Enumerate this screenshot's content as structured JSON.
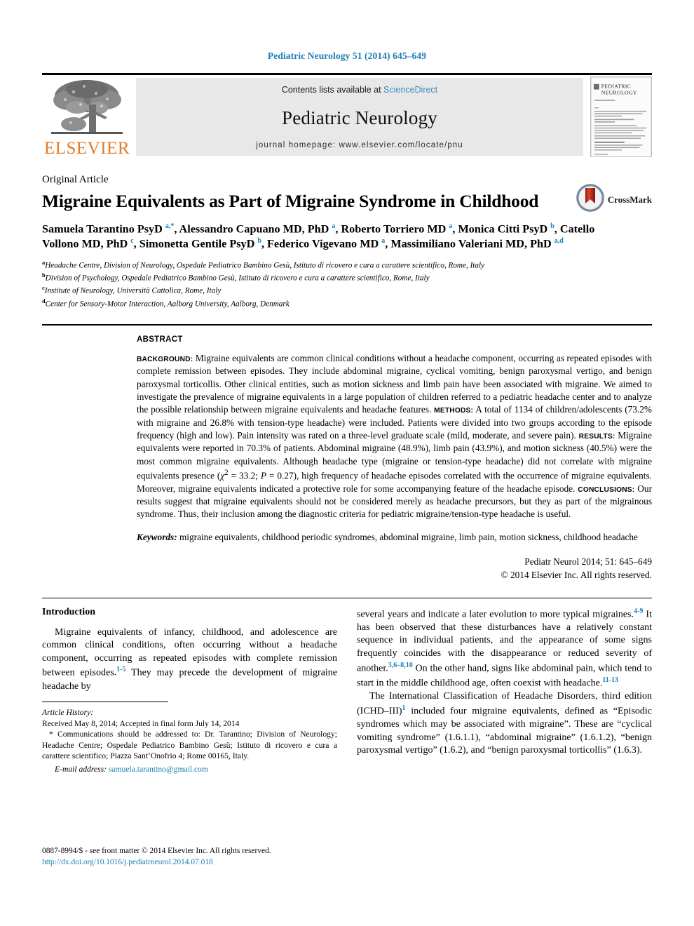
{
  "running_head": "Pediatric Neurology 51 (2014) 645–649",
  "masthead": {
    "elsevier_wordmark": "ELSEVIER",
    "contents_prefix": "Contents lists available at ",
    "sciencedirect": "ScienceDirect",
    "journal_title": "Pediatric Neurology",
    "homepage": "journal homepage: www.elsevier.com/locate/pnu",
    "cover_title_line1": "PEDIATRIC",
    "cover_title_line2": "NEUROLOGY"
  },
  "article": {
    "kicker": "Original Article",
    "title": "Migraine Equivalents as Part of Migraine Syndrome in Childhood",
    "crossmark_label": "CrossMark",
    "authors_html": "Samuela Tarantino PsyD <sup>a,*</sup>, Alessandro Capuano MD, PhD <sup>a</sup>, Roberto Torriero MD <sup>a</sup>, Monica Citti PsyD <sup>b</sup>, Catello Vollono MD, PhD <sup>c</sup>, Simonetta Gentile PsyD <sup>b</sup>, Federico Vigevano MD <sup>a</sup>, Massimiliano Valeriani MD, PhD <sup>a,d</sup>",
    "affiliations": [
      {
        "mark": "a",
        "text": "Headache Centre, Division of Neurology, Ospedale Pediatrico Bambino Gesù, Istituto di ricovero e cura a carattere scientifico, Rome, Italy"
      },
      {
        "mark": "b",
        "text": "Division of Psychology, Ospedale Pediatrico Bambino Gesù, Istituto di ricovero e cura a carattere scientifico, Rome, Italy"
      },
      {
        "mark": "c",
        "text": "Institute of Neurology, Università Cattolica, Rome, Italy"
      },
      {
        "mark": "d",
        "text": "Center for Sensory-Motor Interaction, Aalborg University, Aalborg, Denmark"
      }
    ]
  },
  "abstract": {
    "label": "ABSTRACT",
    "background_label": "BACKGROUND:",
    "background_text": " Migraine equivalents are common clinical conditions without a headache component, occurring as repeated episodes with complete remission between episodes. They include abdominal migraine, cyclical vomiting, benign paroxysmal vertigo, and benign paroxysmal torticollis. Other clinical entities, such as motion sickness and limb pain have been associated with migraine. We aimed to investigate the prevalence of migraine equivalents in a large population of children referred to a pediatric headache center and to analyze the possible relationship between migraine equivalents and headache features. ",
    "methods_label": "METHODS:",
    "methods_text": " A total of 1134 of children/adolescents (73.2% with migraine and 26.8% with tension-type headache) were included. Patients were divided into two groups according to the episode frequency (high and low). Pain intensity was rated on a three-level graduate scale (mild, moderate, and severe pain). ",
    "results_label": "RESULTS:",
    "results_text_1": " Migraine equivalents were reported in 70.3% of patients. Abdominal migraine (48.9%), limb pain (43.9%), and motion sickness (40.5%) were the most common migraine equivalents. Although headache type (migraine or tension-type headache) did not correlate with migraine equivalents presence (",
    "chi_symbol": "χ",
    "chi_exp": "2",
    "chi_value": " = 33.2; ",
    "p_italic": "P",
    "p_value": " = 0.27), high frequency of headache episodes correlated with the occurrence of migraine equivalents. Moreover, migraine equivalents indicated a protective role for some accompanying feature of the headache episode. ",
    "conclusions_label": "CONCLUSIONS:",
    "conclusions_text": " Our results suggest that migraine equivalents should not be considered merely as headache precursors, but they as part of the migrainous syndrome. Thus, their inclusion among the diagnostic criteria for pediatric migraine/tension-type headache is useful.",
    "keywords_label": "Keywords:",
    "keywords_text": " migraine equivalents, childhood periodic syndromes, abdominal migraine, limb pain, motion sickness, childhood headache",
    "citation": "Pediatr Neurol 2014; 51: 645–649",
    "copyright": "© 2014 Elsevier Inc. All rights reserved."
  },
  "body": {
    "intro_heading": "Introduction",
    "left_para_1_a": "Migraine equivalents of infancy, childhood, and adolescence are common clinical conditions, often occurring without a headache component, occurring as repeated episodes with complete remission between episodes.",
    "left_para_1_ref": "1-5",
    "left_para_1_b": " They may precede the development of migraine headache by",
    "right_para_1_a": "several years and indicate a later evolution to more typical migraines.",
    "right_para_1_ref": "4-9",
    "right_para_1_b": " It has been observed that these disturbances have a relatively constant sequence in individual patients, and the appearance of some signs frequently coincides with the disappearance or reduced severity of another.",
    "right_para_1_ref2": "3,6–8,10",
    "right_para_1_c": " On the other hand, signs like abdominal pain, which tend to start in the middle childhood age, often coexist with headache.",
    "right_para_1_ref3": "11-13",
    "right_para_2_a": "The International Classification of Headache Disorders, third edition (ICHD–III)",
    "right_para_2_ref": "1",
    "right_para_2_b": " included four migraine equivalents, defined as “Episodic syndromes which may be associated with migraine”. These are “cyclical vomiting syndrome” (1.6.1.1), “abdominal migraine” (1.6.1.2), “benign paroxysmal vertigo” (1.6.2), and “benign paroxysmal torticollis” (1.6.3)."
  },
  "footnote": {
    "history_label": "Article History:",
    "history_text": "Received May 8, 2014; Accepted in final form July 14, 2014",
    "correspondence": "* Communications should be addressed to: Dr. Tarantino; Division of Neurology; Headache Centre; Ospedale Pediatrico Bambino Gesù; Istituto di ricovero e cura a carattere scientifico; Piazza Sant’Onofrio 4; Rome 00165, Italy.",
    "email_label": "E-mail address:",
    "email": "samuela.tarantino@gmail.com"
  },
  "bottom": {
    "issn_line": "0887-8994/$ - see front matter © 2014 Elsevier Inc. All rights reserved.",
    "doi": "http://dx.doi.org/10.1016/j.pediatrneurol.2014.07.018"
  },
  "colors": {
    "link_blue": "#1a7fb5",
    "sciencedirect_blue": "#3c8dbc",
    "elsevier_orange": "#e87722",
    "band_gray": "#e8e8e8"
  }
}
